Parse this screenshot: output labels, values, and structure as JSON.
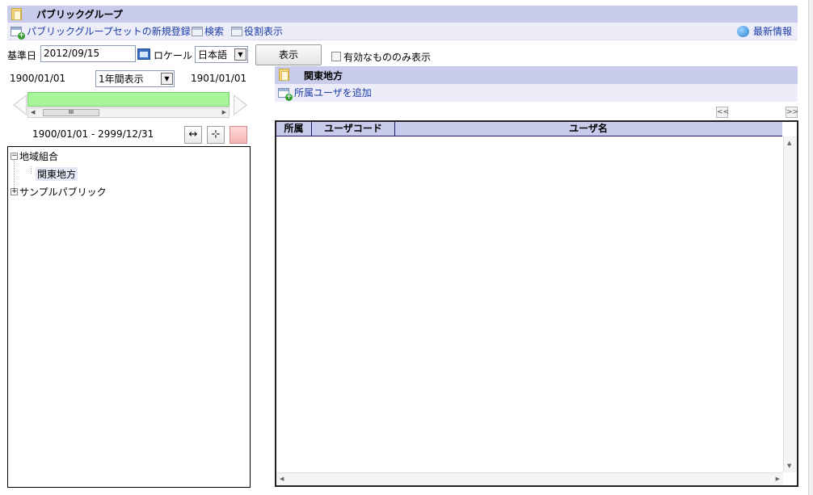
{
  "header": {
    "title": "パブリックグループ",
    "actions": {
      "new_set": "パブリックグループセットの新規登録",
      "search": "検索",
      "role_display": "役割表示",
      "latest_info": "最新情報"
    }
  },
  "filters": {
    "base_date_label": "基準日",
    "base_date_value": "2012/09/15",
    "locale_label": "ロケール",
    "locale_value": "日本語",
    "show_button": "表示",
    "valid_only_label": "有効なもののみ表示"
  },
  "timeline": {
    "start_date": "1900/01/01",
    "range_select": "1年間表示",
    "end_date": "1901/01/01",
    "period_text": "1900/01/01 - 2999/12/31",
    "scroll_thumb": "III"
  },
  "tree": {
    "nodes": [
      {
        "label": "地域組合",
        "expanded": true
      },
      {
        "label": "関東地方",
        "selected": true
      },
      {
        "label": "サンプルパブリック",
        "expanded": false
      }
    ]
  },
  "detail": {
    "title": "関東地方",
    "add_member": "所属ユーザを追加",
    "pager": {
      "prev": "<<",
      "next": ">>"
    },
    "columns": [
      "所属",
      "ユーザコード",
      "ユーザ名"
    ]
  },
  "colors": {
    "header_band": "#c9cbec",
    "action_band": "#ecedf8",
    "link": "#1a3aa8",
    "period_bar": "#a8f59a"
  }
}
